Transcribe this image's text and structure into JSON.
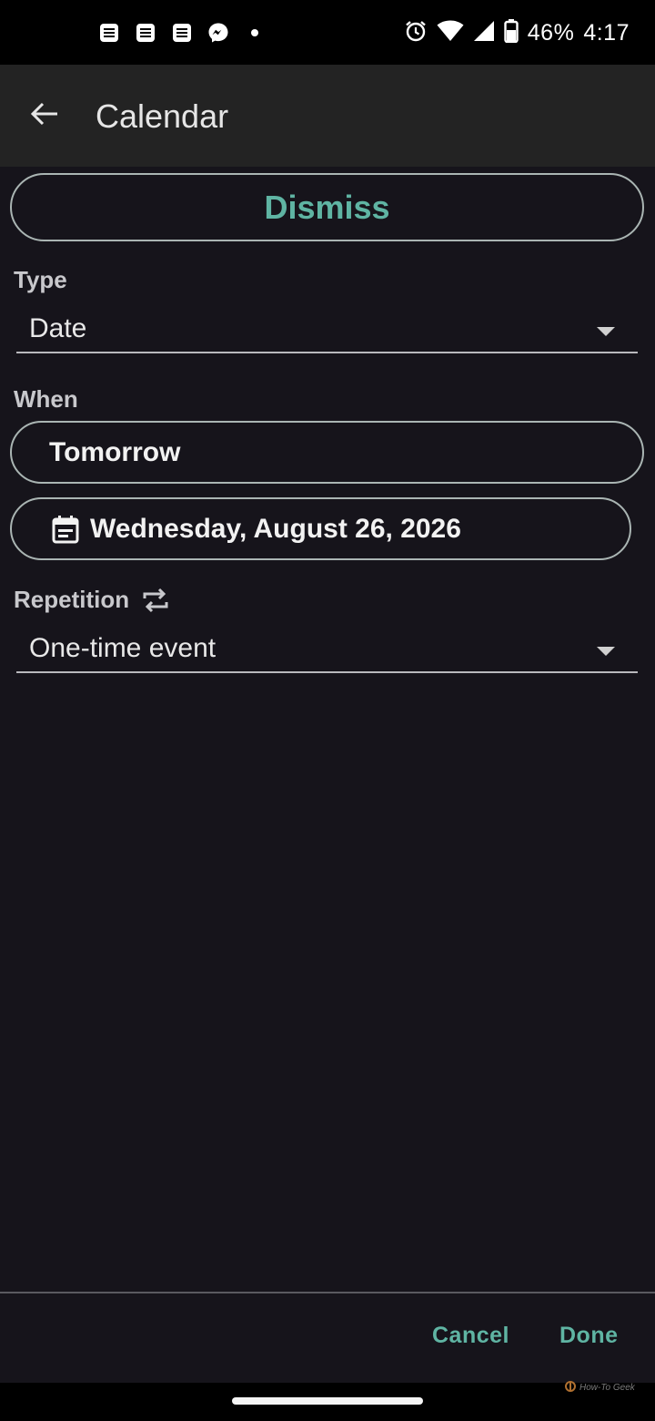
{
  "status_bar": {
    "battery": "46%",
    "time": "4:17",
    "notification_icons": [
      "news-icon",
      "news-icon",
      "news-icon",
      "messenger-icon",
      "dot-icon"
    ],
    "system_icons": [
      "alarm-icon",
      "wifi-icon",
      "signal-icon",
      "battery-icon"
    ]
  },
  "app_bar": {
    "back_icon": "arrow-left-icon",
    "title": "Calendar"
  },
  "dismiss": {
    "label": "Dismiss"
  },
  "type_section": {
    "label": "Type",
    "selected": "Date"
  },
  "when_section": {
    "label": "When",
    "preset": "Tomorrow",
    "date_icon": "calendar-icon",
    "date": "Wednesday, August 26, 2026"
  },
  "repetition_section": {
    "label": "Repetition",
    "icon": "repeat-icon",
    "selected": "One-time event"
  },
  "footer": {
    "cancel_label": "Cancel",
    "done_label": "Done"
  },
  "watermark": {
    "text": "How-To Geek"
  },
  "colors": {
    "background": "#16141b",
    "app_bar": "#232323",
    "accent": "#5fb4a3",
    "outline": "#aab5b3"
  }
}
